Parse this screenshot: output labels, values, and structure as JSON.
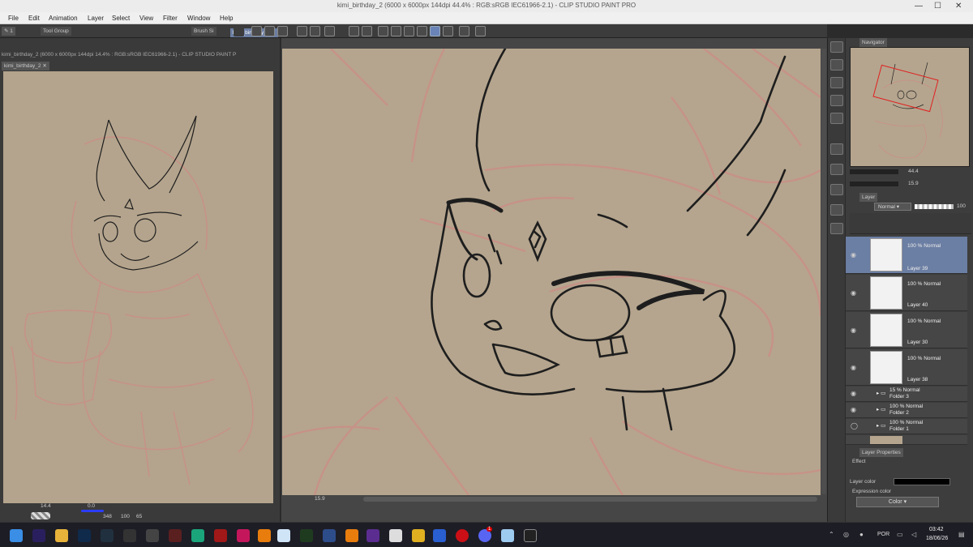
{
  "window": {
    "title": "kimi_birthday_2 (6000 x 6000px 144dpi 44.4% : RGB:sRGB IEC61966-2.1) - CLIP STUDIO PAINT PRO"
  },
  "menu": [
    "File",
    "Edit",
    "Animation",
    "Layer",
    "Select",
    "View",
    "Filter",
    "Window",
    "Help"
  ],
  "toolbar": {
    "tool_group": "Tool Group",
    "brush_size": "Brush Si",
    "tab_main": "kimi_birthday_2"
  },
  "left_view": {
    "title": "kimi_birthday_2 (6000 x 6000px 144dpi 14.4% : RGB:sRGB IEC61966-2.1) - CLIP STUDIO PAINT P",
    "tab": "kimi_birthday_2",
    "zoom": "14.4",
    "angle": "0.0",
    "coords": "348",
    "coords2": "100",
    "value3": "65"
  },
  "main_view": {
    "zoom": "15.9"
  },
  "navigator": {
    "title": "Navigator",
    "zoom": "44.4",
    "angle": "15.9"
  },
  "layer_panel": {
    "tab": "Layer",
    "blend_mode": "Normal",
    "opacity": "100",
    "layers": [
      {
        "name": "Layer 39",
        "info": "100 % Normal"
      },
      {
        "name": "Layer 40",
        "info": "100 % Normal"
      },
      {
        "name": "Layer 30",
        "info": "100 % Normal"
      },
      {
        "name": "Layer 38",
        "info": "100 % Normal"
      },
      {
        "name": "Folder 3",
        "info": "15 % Normal"
      },
      {
        "name": "Folder 2",
        "info": "100 % Normal"
      },
      {
        "name": "Folder 1",
        "info": "100 % Normal"
      }
    ]
  },
  "layer_properties": {
    "tab": "Layer Properties",
    "effect": "Effect",
    "layer_color": "Layer color",
    "expression_color": "Expression color",
    "expression_value": "Color"
  },
  "taskbar": {
    "lang": "POR",
    "time": "03:42",
    "date": "18/06/26",
    "notif": "1"
  },
  "colors": {
    "canvas": "#b5a58e",
    "sketch": "#c98f86",
    "ink": "#1e1e1e",
    "selected_layer": "#6b7ea3"
  }
}
